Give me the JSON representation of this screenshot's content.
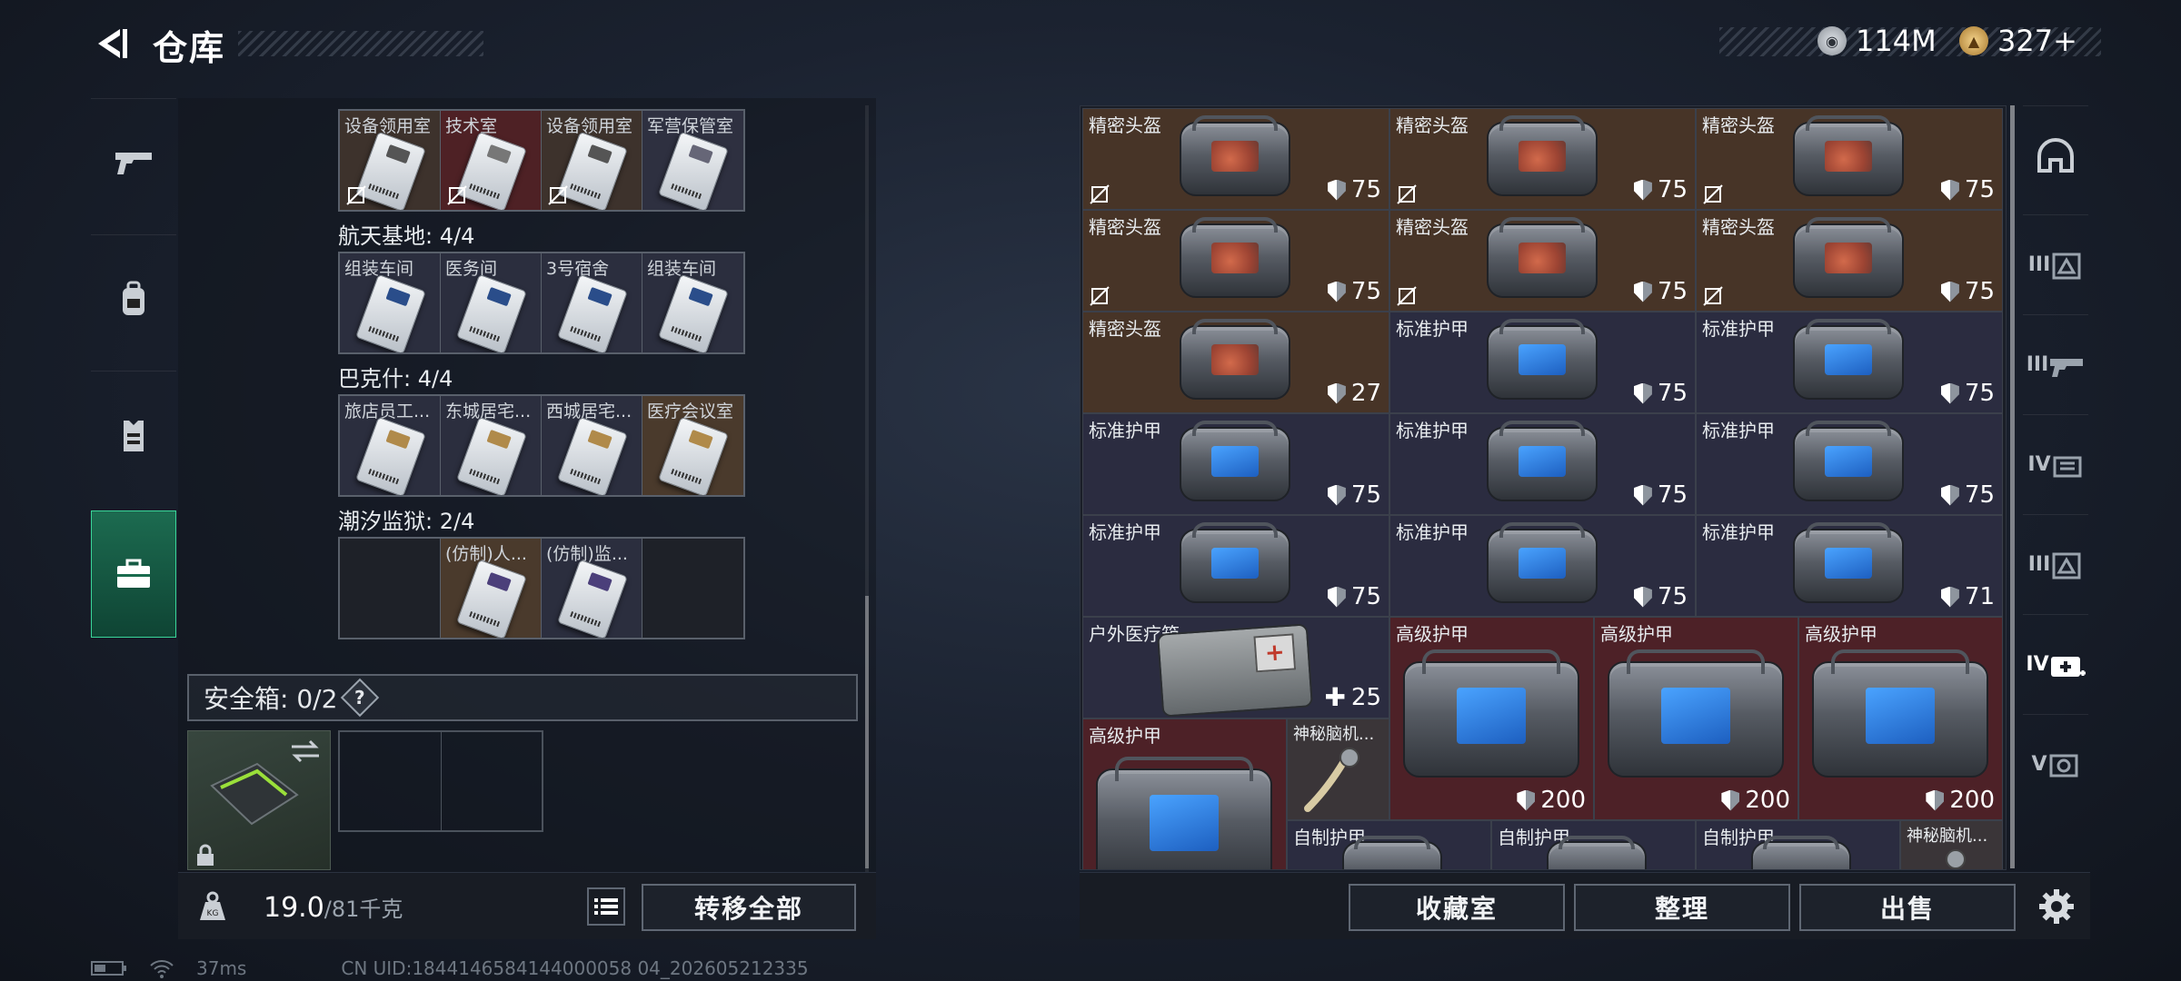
{
  "header": {
    "title": "仓库",
    "currency": [
      {
        "icon": "silver-coin-icon",
        "value": "114M"
      },
      {
        "icon": "gold-coin-icon",
        "value": "327+"
      }
    ]
  },
  "left_tabs": [
    {
      "icon": "gun-icon"
    },
    {
      "icon": "backpack-icon"
    },
    {
      "icon": "vest-icon"
    },
    {
      "icon": "toolbox-icon",
      "active": true
    }
  ],
  "keycards": {
    "top_row": [
      "设备领用室",
      "技术室",
      "设备领用室",
      "军营保管室"
    ],
    "sections": [
      {
        "label": "航天基地: 4/4",
        "cards": [
          "组装车间",
          "医务间",
          "3号宿舍",
          "组装车间"
        ]
      },
      {
        "label": "巴克什: 4/4",
        "cards": [
          "旅店员工...",
          "东城居宅...",
          "西城居宅...",
          "医疗会议室"
        ]
      },
      {
        "label": "潮汐监狱: 2/4",
        "cards": [
          "",
          "(仿制)人...",
          "(仿制)监...",
          ""
        ]
      }
    ]
  },
  "safe_box": {
    "label": "安全箱: 0/2",
    "help": "?"
  },
  "footer_left": {
    "weight": "19.0",
    "capacity": "/81千克",
    "transfer_all": "转移全部"
  },
  "items": [
    {
      "name": "精密头盔",
      "value": "75"
    },
    {
      "name": "精密头盔",
      "value": "75"
    },
    {
      "name": "精密头盔",
      "value": "75"
    },
    {
      "name": "精密头盔",
      "value": "75"
    },
    {
      "name": "精密头盔",
      "value": "75"
    },
    {
      "name": "精密头盔",
      "value": "75"
    },
    {
      "name": "精密头盔",
      "value": "27"
    },
    {
      "name": "标准护甲",
      "value": "75"
    },
    {
      "name": "标准护甲",
      "value": "75"
    },
    {
      "name": "标准护甲",
      "value": "75"
    },
    {
      "name": "标准护甲",
      "value": "75"
    },
    {
      "name": "标准护甲",
      "value": "75"
    },
    {
      "name": "标准护甲",
      "value": "75"
    },
    {
      "name": "标准护甲",
      "value": "75"
    },
    {
      "name": "标准护甲",
      "value": "71"
    },
    {
      "name": "户外医疗箱",
      "value": "25"
    },
    {
      "name": "高级护甲",
      "value": "200"
    },
    {
      "name": "高级护甲",
      "value": "200"
    },
    {
      "name": "高级护甲",
      "value": "200"
    },
    {
      "name": "高级护甲",
      "value": ""
    },
    {
      "name": "神秘脑机...",
      "value": ""
    },
    {
      "name": "自制护甲",
      "value": ""
    },
    {
      "name": "自制护甲",
      "value": ""
    },
    {
      "name": "自制护甲",
      "value": ""
    },
    {
      "name": "神秘脑机...",
      "value": ""
    }
  ],
  "right_tabs": [
    "",
    "III",
    "III",
    "IV",
    "III",
    "IV",
    "V"
  ],
  "footer_right": {
    "collection": "收藏室",
    "organize": "整理",
    "sell": "出售"
  },
  "status": {
    "ping": "37ms",
    "uid": "CN UID:1844146584144000058 04_202605212335"
  }
}
